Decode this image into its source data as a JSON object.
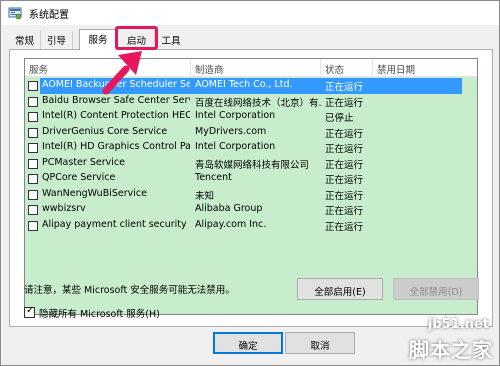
{
  "window": {
    "title": "系统配置",
    "icon": "system-config-icon"
  },
  "tabs": [
    {
      "label": "常规",
      "active": false
    },
    {
      "label": "引导",
      "active": false
    },
    {
      "label": "服务",
      "active": true
    },
    {
      "label": "启动",
      "active": false
    },
    {
      "label": "工具",
      "active": false
    }
  ],
  "services": {
    "columns": [
      "服务",
      "制造商",
      "状态",
      "禁用日期"
    ],
    "rows": [
      {
        "name": "AOMEI Backupper Scheduler Ser...",
        "vendor": "AOMEI Tech Co., Ltd.",
        "status": "正在运行",
        "date": "",
        "checked": false,
        "selected": true
      },
      {
        "name": "Baidu Browser Safe Center Service",
        "vendor": "百度在线网络技术（北京）有...",
        "status": "正在运行",
        "date": "",
        "checked": false,
        "selected": false
      },
      {
        "name": "Intel(R) Content Protection HECI ...",
        "vendor": "Intel Corporation",
        "status": "已停止",
        "date": "",
        "checked": false,
        "selected": false
      },
      {
        "name": "DriverGenius Core Service",
        "vendor": "MyDrivers.com",
        "status": "正在运行",
        "date": "",
        "checked": false,
        "selected": false
      },
      {
        "name": "Intel(R) HD Graphics Control Pan...",
        "vendor": "Intel Corporation",
        "status": "正在运行",
        "date": "",
        "checked": false,
        "selected": false
      },
      {
        "name": "PCMaster Service",
        "vendor": "青岛软媒网络科技有限公司",
        "status": "正在运行",
        "date": "",
        "checked": false,
        "selected": false
      },
      {
        "name": "QPCore Service",
        "vendor": "Tencent",
        "status": "正在运行",
        "date": "",
        "checked": false,
        "selected": false
      },
      {
        "name": "WanNengWuBiService",
        "vendor": "未知",
        "status": "正在运行",
        "date": "",
        "checked": false,
        "selected": false
      },
      {
        "name": "wwbizsrv",
        "vendor": "Alibaba Group",
        "status": "正在运行",
        "date": "",
        "checked": false,
        "selected": false
      },
      {
        "name": "Alipay payment client security ser...",
        "vendor": "Alipay.com Inc.",
        "status": "正在运行",
        "date": "",
        "checked": false,
        "selected": false
      }
    ]
  },
  "note": "请注意，某些 Microsoft 安全服务可能无法禁用。",
  "buttons": {
    "enable_all": "全部启用(E)",
    "disable_all": "全部禁用(D)",
    "ok": "确定",
    "cancel": "取消"
  },
  "hide_ms": {
    "label": "隐藏所有 Microsoft 服务(H)",
    "checked": true
  },
  "watermark": {
    "url": "jb51.net",
    "text": "脚本之家"
  },
  "colors": {
    "list_background": "#c7edcc",
    "selection": "#3399ff",
    "highlight_box": "#e6175c"
  }
}
